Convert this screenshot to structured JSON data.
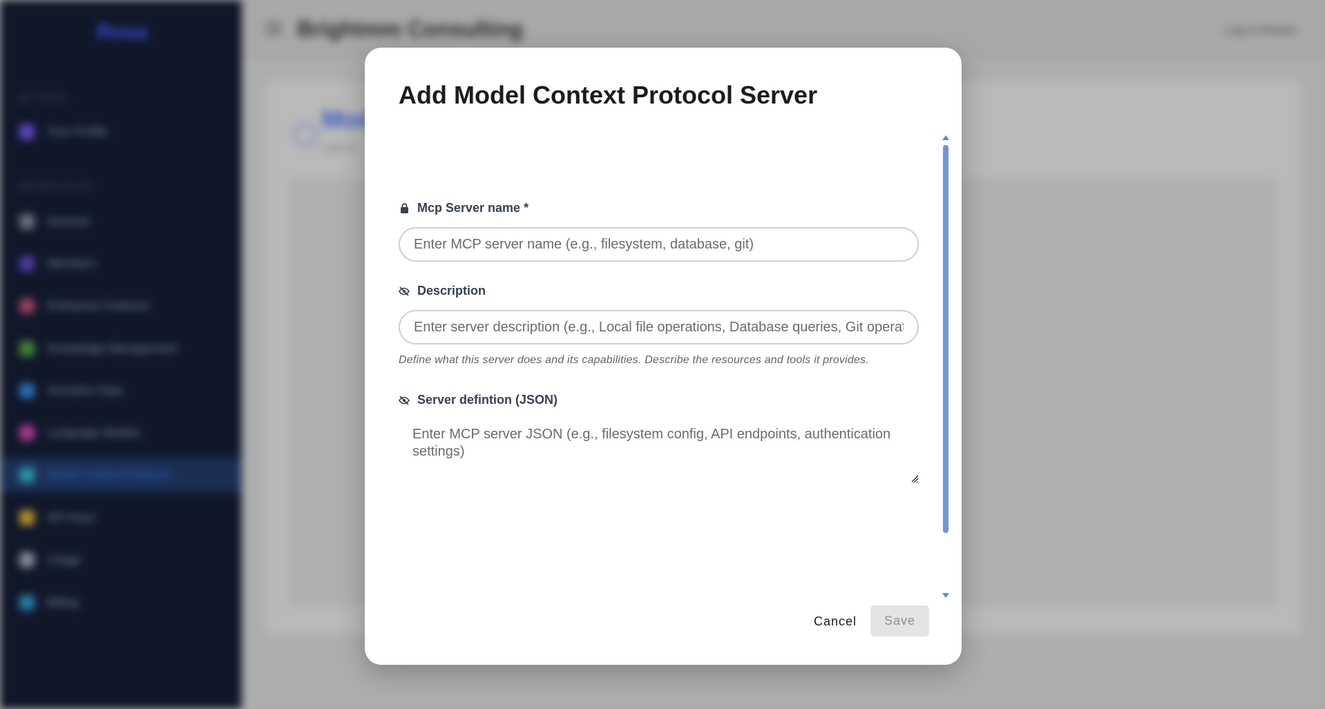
{
  "background": {
    "sidebar": {
      "logo": "Rosa",
      "sections": [
        {
          "label": "SETTINGS"
        },
        {
          "label": "ORGANIZATION"
        }
      ],
      "items": [
        {
          "label": "Your Profile",
          "color": "#6b4fd8"
        },
        {
          "label": "General",
          "color": "#7d7f8a"
        },
        {
          "label": "Members",
          "color": "#5b3fb5"
        },
        {
          "label": "Enterprise Features",
          "color": "#b5476a"
        },
        {
          "label": "Knowledge Management",
          "color": "#4f9b3a"
        },
        {
          "label": "Sensitive Data",
          "color": "#2f7fcf"
        },
        {
          "label": "Language Models",
          "color": "#c63ea0"
        },
        {
          "label": "Model Context Protocol",
          "color": "#2fa7b8",
          "active": true
        },
        {
          "label": "API Keys",
          "color": "#d4a72c"
        },
        {
          "label": "Usage",
          "color": "#9aa0ab"
        },
        {
          "label": "Billing",
          "color": "#2f8fb8"
        }
      ]
    },
    "header": {
      "title": "Brightmm Consulting",
      "logout": "Log in Details"
    },
    "card": {
      "title": "Model",
      "subtitle": "List of"
    }
  },
  "dialog": {
    "title": "Add Model Context Protocol Server",
    "fields": {
      "name": {
        "label": "Mcp Server name *",
        "icon": "lock-icon",
        "placeholder": "Enter MCP server name (e.g., filesystem, database, git)",
        "value": ""
      },
      "description": {
        "label": "Description",
        "icon": "eye-off-icon",
        "placeholder": "Enter server description (e.g., Local file operations, Database queries, Git operations)",
        "value": "",
        "helper": "Define what this server does and its capabilities. Describe the resources and tools it provides."
      },
      "definition": {
        "label": "Server defintion (JSON)",
        "icon": "eye-off-icon",
        "placeholder": "Enter MCP server JSON (e.g., filesystem config, API endpoints, authentication settings)",
        "value": ""
      }
    },
    "actions": {
      "cancel": "Cancel",
      "save": "Save"
    }
  }
}
